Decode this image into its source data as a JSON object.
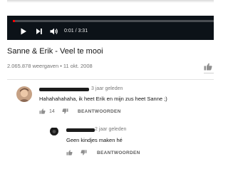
{
  "player": {
    "time": "0:01 / 3:31",
    "progress_fraction": 0.005,
    "accent": "#ff0000",
    "icons": [
      "play-icon",
      "next-icon",
      "volume-icon"
    ]
  },
  "video": {
    "title": "Sanne & Erik - Veel te mooi",
    "meta": "2.065.878 weergaven • 11 okt. 2008"
  },
  "comments": [
    {
      "timestamp": "3 jaar geleden",
      "text": "Hahahahahaha, ik heet Erik en mijn zus heet Sanne ;)",
      "likes": "14",
      "reply_label": "BEANTWOORDEN"
    }
  ],
  "reply": {
    "timestamp": "2 jaar geleden",
    "text": "Geen kindjes maken hé",
    "reply_label": "BEANTWOORDEN"
  }
}
